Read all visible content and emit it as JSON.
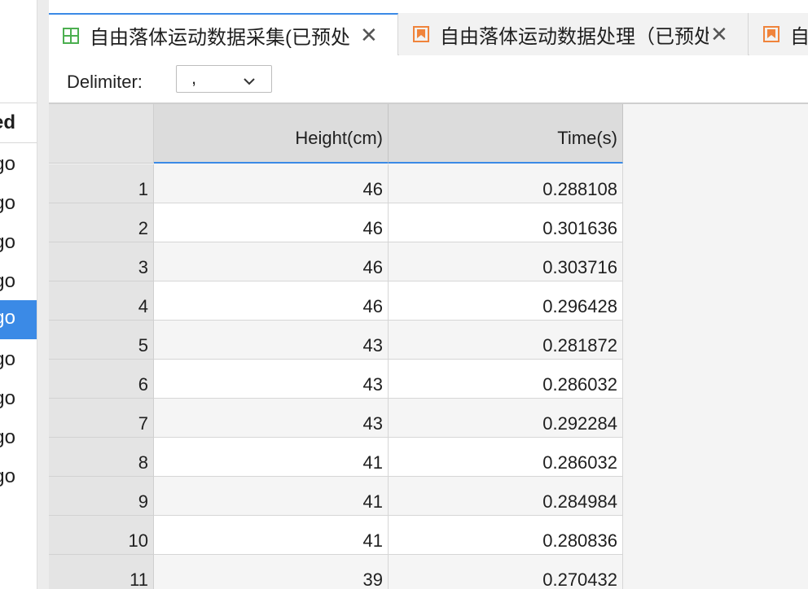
{
  "sidebar": {
    "header": "ed",
    "items": [
      "go",
      "go",
      "go",
      "go",
      "go",
      "go",
      "go",
      "go",
      "go"
    ],
    "selected_index": 4
  },
  "tabs": [
    {
      "title": "自由落体运动数据采集(已预处",
      "icon": "table-grid-icon",
      "active": true
    },
    {
      "title": "自由落体运动数据处理（已预处",
      "icon": "bookmark-icon",
      "active": false
    },
    {
      "title": "自由",
      "icon": "bookmark-icon",
      "active": false
    }
  ],
  "toolbar": {
    "delimiter_label": "Delimiter:",
    "delimiter_value": ","
  },
  "table": {
    "columns": [
      "Height(cm)",
      "Time(s)"
    ],
    "rows": [
      {
        "index": "1",
        "height": "46",
        "time": "0.288108"
      },
      {
        "index": "2",
        "height": "46",
        "time": "0.301636"
      },
      {
        "index": "3",
        "height": "46",
        "time": "0.303716"
      },
      {
        "index": "4",
        "height": "46",
        "time": "0.296428"
      },
      {
        "index": "5",
        "height": "43",
        "time": "0.281872"
      },
      {
        "index": "6",
        "height": "43",
        "time": "0.286032"
      },
      {
        "index": "7",
        "height": "43",
        "time": "0.292284"
      },
      {
        "index": "8",
        "height": "41",
        "time": "0.286032"
      },
      {
        "index": "9",
        "height": "41",
        "time": "0.284984"
      },
      {
        "index": "10",
        "height": "41",
        "time": "0.280836"
      },
      {
        "index": "11",
        "height": "39",
        "time": "0.270432"
      }
    ]
  },
  "colors": {
    "accent": "#3b8ae6",
    "table_icon": "#4caf50",
    "bookmark_icon": "#f0843c"
  }
}
